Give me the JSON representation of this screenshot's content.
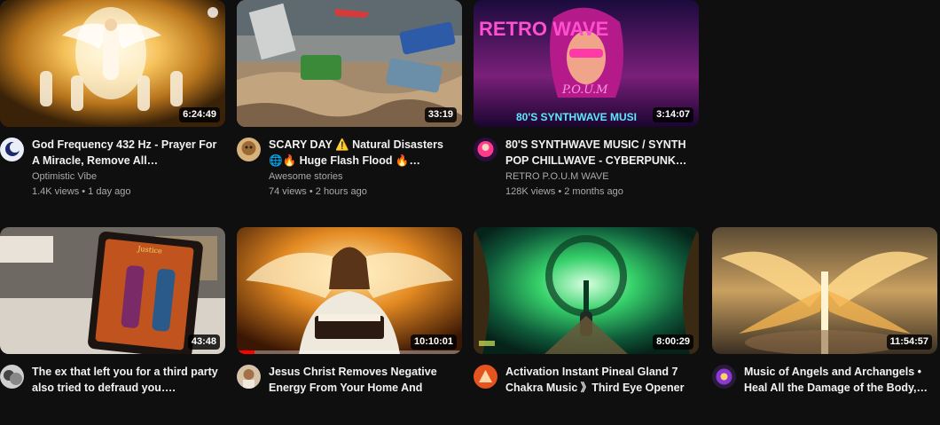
{
  "videos": [
    {
      "title": "God Frequency 432 Hz - Prayer For A Miracle, Remove All…",
      "channel": "Optimistic Vibe",
      "views": "1.4K views",
      "age": "1 day ago",
      "duration": "6:24:49"
    },
    {
      "title": "SCARY DAY ⚠️ Natural Disasters 🌐🔥 Huge Flash Flood 🔥…",
      "channel": "Awesome stories",
      "views": "74 views",
      "age": "2 hours ago",
      "duration": "33:19"
    },
    {
      "title": "80'S SYNTHWAVE MUSIC / SYNTH POP CHILLWAVE - CYBERPUNK…",
      "channel": "RETRO P.O.U.M WAVE",
      "views": "128K views",
      "age": "2 months ago",
      "duration": "3:14:07",
      "thumb_text_top": "RETRO WAVE",
      "thumb_text_mid": "P.O.U.M",
      "thumb_text_bottom": "80'S SYNTHWAVE MUSI"
    },
    {
      "title": "The ex that left you for a third party also tried to defraud you….",
      "channel": "",
      "views": "",
      "age": "",
      "duration": "43:48",
      "thumb_card_label": "Justice"
    },
    {
      "title": "Jesus Christ Removes Negative Energy From Your Home And Min…",
      "channel": "",
      "views": "",
      "age": "",
      "duration": "10:10:01",
      "watched_fraction": 0.08
    },
    {
      "title": "Activation Instant Pineal Gland 7 Chakra Music 》Third Eye Opener …",
      "channel": "",
      "views": "",
      "age": "",
      "duration": "8:00:29"
    },
    {
      "title": "Music of Angels and Archangels • Heal All the Damage of the Body,…",
      "channel": "",
      "views": "",
      "age": "",
      "duration": "11:54:57"
    }
  ],
  "stats_separator": " • "
}
